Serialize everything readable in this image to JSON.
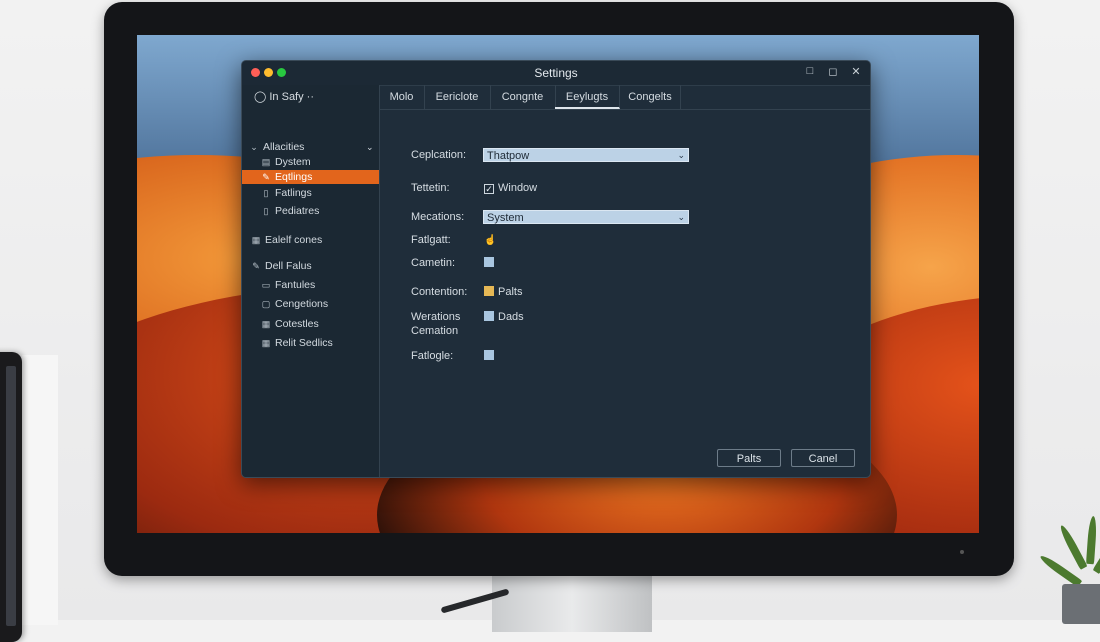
{
  "window": {
    "title": "Settings",
    "controls": {
      "minimize": "□",
      "restore": "◻",
      "close": "✕"
    }
  },
  "sidebar": {
    "search": "In Safy ··",
    "items": [
      {
        "label": "Allacities",
        "icon": "chevron-down",
        "trail": "⌄"
      },
      {
        "label": "Dystem",
        "icon": "document"
      },
      {
        "label": "Eqtlings",
        "icon": "pencil",
        "active": true
      },
      {
        "label": "Fatlings",
        "icon": "file"
      },
      {
        "label": "Pediatres",
        "icon": "file"
      },
      {
        "label": "Ealelf cones",
        "icon": "grid"
      },
      {
        "label": "Dell Falus",
        "icon": "pencil"
      },
      {
        "label": "Fantules",
        "icon": "folder"
      },
      {
        "label": "Cengetions",
        "icon": "box"
      },
      {
        "label": "Cotestles",
        "icon": "grid"
      },
      {
        "label": "Relit Sedlics",
        "icon": "grid"
      }
    ]
  },
  "tabs": [
    {
      "label": "Molo"
    },
    {
      "label": "Eericlote"
    },
    {
      "label": "Congnte"
    },
    {
      "label": "Eeylugts",
      "active": true
    },
    {
      "label": "Congelts"
    }
  ],
  "form": {
    "rows": [
      {
        "label": "Ceplcation:",
        "type": "select",
        "value": "Thatpow"
      },
      {
        "label": "Tettetin:",
        "type": "checkbox",
        "value": "Window"
      },
      {
        "label": "Mecations:",
        "type": "select",
        "value": "System"
      },
      {
        "label": "Fatlgatt:",
        "type": "icon",
        "value": "☝"
      },
      {
        "label": "Cametin:",
        "type": "swatch",
        "value": ""
      },
      {
        "label": "Contention:",
        "type": "swatch-yellow",
        "value": "Palts"
      },
      {
        "label": "Werations",
        "label2": "Cemation",
        "type": "swatch",
        "value": "Dads"
      },
      {
        "label": "Fatlogle:",
        "type": "swatch",
        "value": ""
      }
    ]
  },
  "buttons": {
    "primary": "Palts",
    "cancel": "Canel"
  },
  "colors": {
    "accent": "#e2651c",
    "window_bg": "#1f2d3a",
    "select_bg": "#bcd2e6"
  }
}
